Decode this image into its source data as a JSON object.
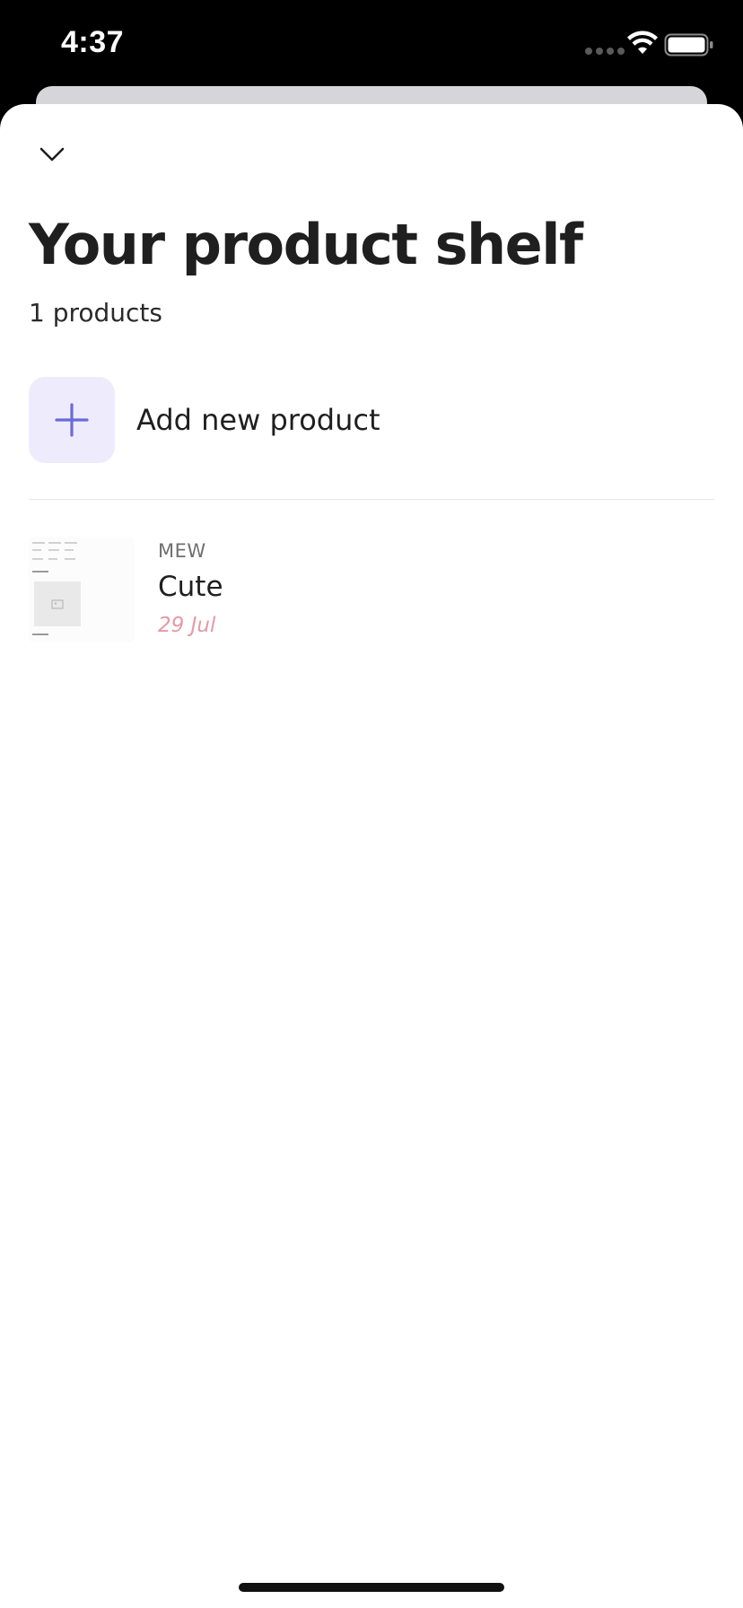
{
  "status_bar": {
    "time": "4:37"
  },
  "header": {
    "collapse_icon": "chevron-down-icon",
    "title": "Your product shelf",
    "count_label": "1 products"
  },
  "add_product": {
    "icon": "plus-icon",
    "label": "Add new product"
  },
  "products": [
    {
      "brand": "MEW",
      "name": "Cute",
      "date": "29 Jul"
    }
  ],
  "colors": {
    "accent": "#6b6bd6",
    "add_tile_bg": "#eeecfc",
    "date_text": "#e39ba6"
  }
}
